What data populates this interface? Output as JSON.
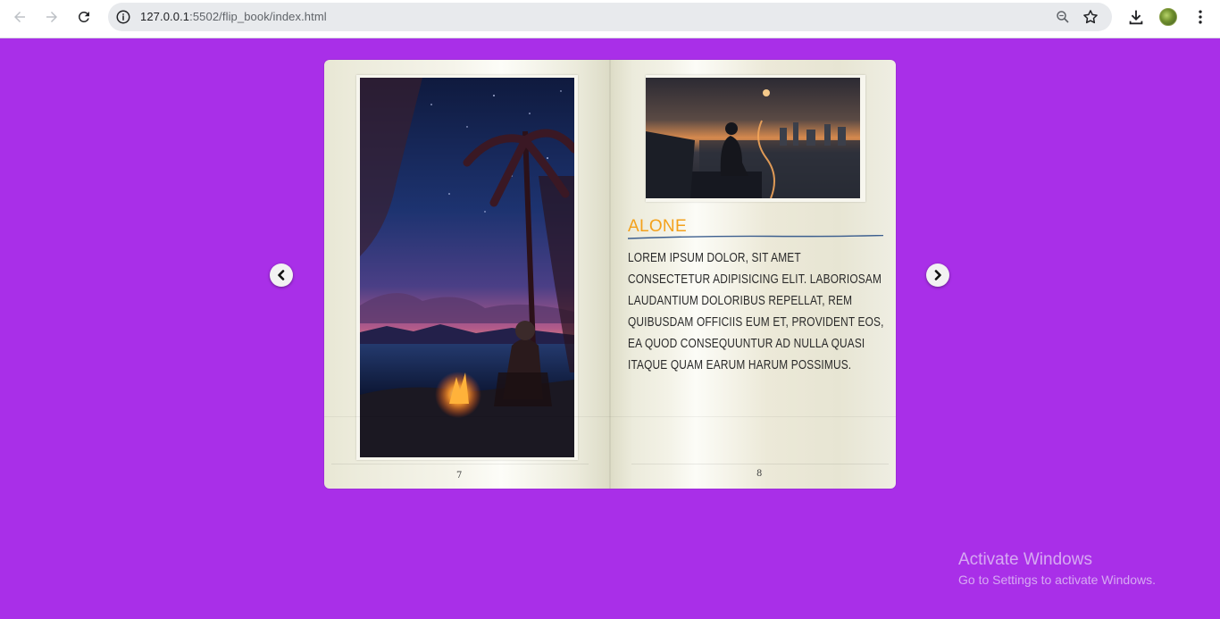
{
  "browser": {
    "url_host": "127.0.0.1",
    "url_rest": ":5502/flip_book/index.html"
  },
  "book": {
    "left_page": {
      "image": "beach-campfire-night-illustration",
      "page_number": "7"
    },
    "right_page": {
      "image": "city-rooftop-sunset-illustration",
      "title": "ALONE",
      "body": "Lorem ipsum dolor, sit amet consectetur adipisicing elit. Laboriosam laudantium doloribus repellat, rem quibusdam officiis eum et, provident eos, ea quod consequuntur ad nulla quasi itaque quam earum harum possimus.",
      "page_number": "8"
    },
    "colors": {
      "background": "#a92fe8",
      "title": "#f4a11c"
    }
  },
  "watermark": {
    "line1": "Activate Windows",
    "line2": "Go to Settings to activate Windows."
  }
}
